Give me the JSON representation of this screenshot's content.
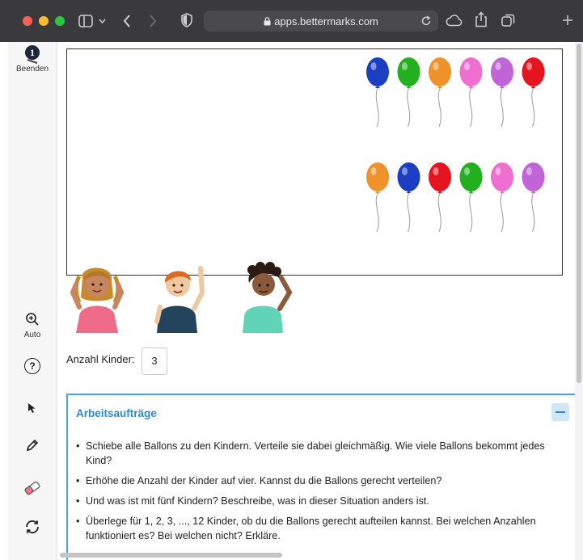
{
  "browser": {
    "url": "apps.bettermarks.com"
  },
  "sidebar": {
    "badge": "1",
    "quit_label": "Beenden",
    "zoom_label": "Auto",
    "help_symbol": "?"
  },
  "count": {
    "label": "Anzahl Kinder:",
    "value": "3"
  },
  "tasks": {
    "title": "Arbeitsaufträge",
    "items": [
      "Schiebe alle Ballons zu den Kindern. Verteile sie dabei gleichmäßig. Wie viele Ballons bekommt jedes Kind?",
      "Erhöhe die Anzahl der Kinder auf vier. Kannst du die Ballons gerecht verteilen?",
      "Und was ist mit fünf Kindern? Beschreibe, was in dieser Situation anders ist.",
      "Überlege für 1, 2, 3, ..., 12 Kinder, ob du die Ballons gerecht aufteilen kannst. Bei welchen Anzahlen funktioniert es? Bei welchen nicht? Erkläre."
    ]
  },
  "balloons": {
    "row1": [
      "#1a3fc4",
      "#22b01f",
      "#f0922a",
      "#ef6fd0",
      "#c064d8",
      "#e5141f"
    ],
    "row2": [
      "#f0922a",
      "#1a3fc4",
      "#e5141f",
      "#22b01f",
      "#ef6fd0",
      "#c064d8"
    ]
  },
  "colors": {
    "accent": "#2b8ad6",
    "panel_border": "#45a4ea"
  }
}
